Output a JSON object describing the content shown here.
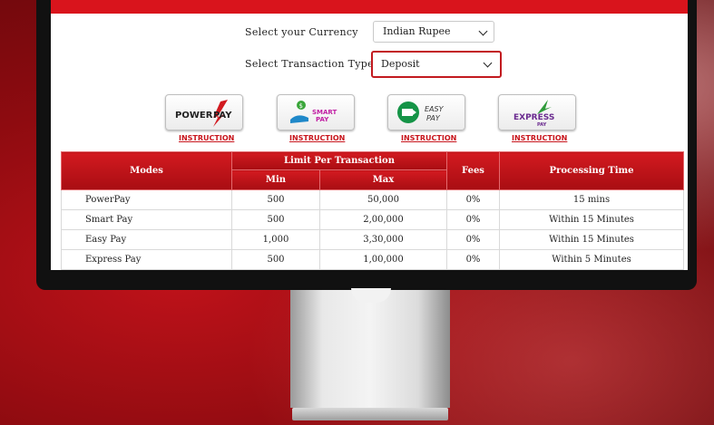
{
  "form": {
    "currency_label": "Select your Currency",
    "currency_value": "Indian Rupee",
    "transaction_label": "Select Transaction Type",
    "transaction_value": "Deposit"
  },
  "pay_options": [
    {
      "name": "POWERPAY",
      "instruction": "INSTRUCTION"
    },
    {
      "name": "SMART PAY",
      "instruction": "INSTRUCTION"
    },
    {
      "name": "EASY PAY",
      "instruction": "INSTRUCTION"
    },
    {
      "name": "EXPRESS PAY",
      "instruction": "INSTRUCTION"
    }
  ],
  "table": {
    "headers": {
      "modes": "Modes",
      "limit": "Limit Per Transaction",
      "min": "Min",
      "max": "Max",
      "fees": "Fees",
      "processing": "Processing Time"
    },
    "rows": [
      {
        "mode": "PowerPay",
        "min": "500",
        "max": "50,000",
        "fees": "0%",
        "time": "15 mins"
      },
      {
        "mode": "Smart Pay",
        "min": "500",
        "max": "2,00,000",
        "fees": "0%",
        "time": "Within 15 Minutes"
      },
      {
        "mode": "Easy Pay",
        "min": "1,000",
        "max": "3,30,000",
        "fees": "0%",
        "time": "Within 15 Minutes"
      },
      {
        "mode": "Express Pay",
        "min": "500",
        "max": "1,00,000",
        "fees": "0%",
        "time": "Within 5 Minutes"
      }
    ]
  },
  "colors": {
    "accent": "#c8151c",
    "header_red": "#b81218",
    "background": "#8e0b10"
  },
  "icons": [
    "chevron-down-icon",
    "powerpay-logo-icon",
    "smartpay-logo-icon",
    "easypay-logo-icon",
    "expresspay-logo-icon"
  ]
}
